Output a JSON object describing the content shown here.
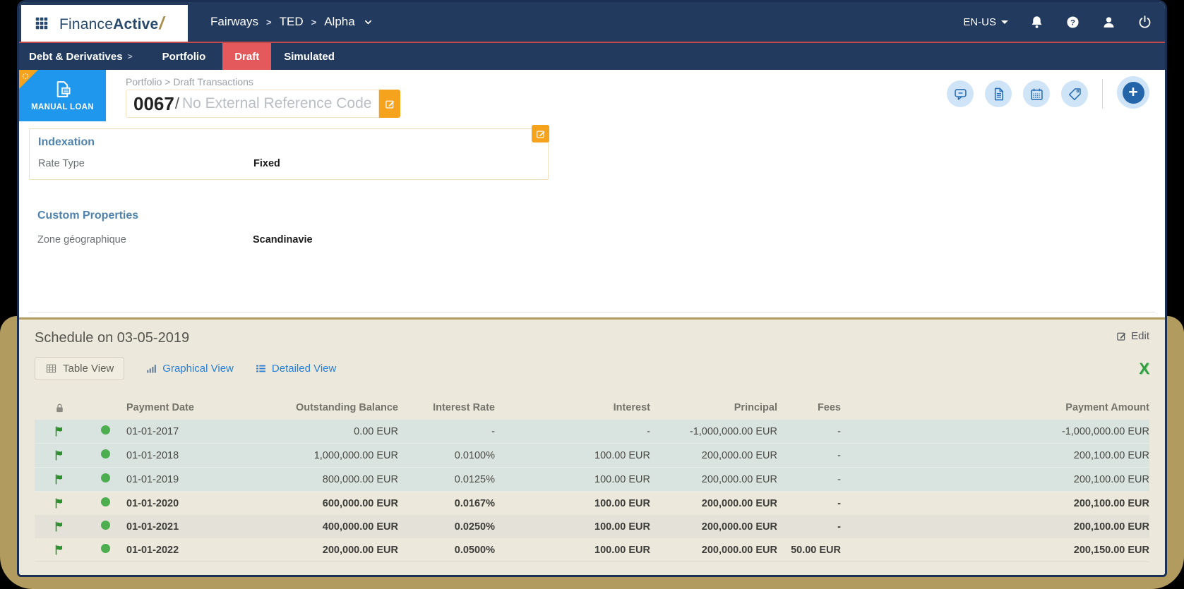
{
  "topnav": {
    "logo_part1": "Finance",
    "logo_part2": "Active",
    "logo_slash": "/",
    "breadcrumb": {
      "org": "Fairways",
      "group": "TED",
      "entity": "Alpha"
    },
    "crumb_sep": ">",
    "language": "EN-US"
  },
  "subnav": {
    "items": [
      {
        "label": "Debt & Derivatives",
        "chevron": ">"
      },
      {
        "label": "Portfolio"
      },
      {
        "label": "Draft",
        "active": true
      },
      {
        "label": "Simulated"
      }
    ]
  },
  "header": {
    "badge_label": "MANUAL LOAN",
    "breadcrumb": "Portfolio > Draft Transactions",
    "loan_code": "0067",
    "separator": "/",
    "reference_placeholder": "No External Reference Code",
    "add_symbol": "+"
  },
  "sections": {
    "indexation": {
      "title": "Indexation",
      "fields": [
        {
          "label": "Rate Type",
          "value": "Fixed"
        }
      ]
    },
    "custom_properties": {
      "title": "Custom Properties",
      "fields": [
        {
          "label": "Zone géographique",
          "value": "Scandinavie"
        }
      ]
    }
  },
  "schedule": {
    "title": "Schedule on 03-05-2019",
    "edit_label": "Edit",
    "export_symbol": "X",
    "tabs": [
      {
        "label": "Table View",
        "active": true
      },
      {
        "label": "Graphical View"
      },
      {
        "label": "Detailed View"
      }
    ],
    "table": {
      "columns": [
        "Payment Date",
        "Outstanding Balance",
        "Interest Rate",
        "Interest",
        "Principal",
        "Fees",
        "Payment Amount"
      ],
      "rows": [
        {
          "date": "01-01-2017",
          "balance": "0.00 EUR",
          "rate": "-",
          "interest": "-",
          "principal": "-1,000,000.00 EUR",
          "fees": "-",
          "amount": "-1,000,000.00 EUR"
        },
        {
          "date": "01-01-2018",
          "balance": "1,000,000.00 EUR",
          "rate": "0.0100%",
          "interest": "100.00 EUR",
          "principal": "200,000.00 EUR",
          "fees": "-",
          "amount": "200,100.00 EUR"
        },
        {
          "date": "01-01-2019",
          "balance": "800,000.00 EUR",
          "rate": "0.0125%",
          "interest": "100.00 EUR",
          "principal": "200,000.00 EUR",
          "fees": "-",
          "amount": "200,100.00 EUR"
        },
        {
          "date": "01-01-2020",
          "balance": "600,000.00 EUR",
          "rate": "0.0167%",
          "interest": "100.00 EUR",
          "principal": "200,000.00 EUR",
          "fees": "-",
          "amount": "200,100.00 EUR"
        },
        {
          "date": "01-01-2021",
          "balance": "400,000.00 EUR",
          "rate": "0.0250%",
          "interest": "100.00 EUR",
          "principal": "200,000.00 EUR",
          "fees": "-",
          "amount": "200,100.00 EUR"
        },
        {
          "date": "01-01-2022",
          "balance": "200,000.00 EUR",
          "rate": "0.0500%",
          "interest": "100.00 EUR",
          "principal": "200,000.00 EUR",
          "fees": "50.00 EUR",
          "amount": "200,150.00 EUR"
        }
      ]
    }
  },
  "icons": {
    "app_launcher": "grid-3x3",
    "nav_right": [
      "bell",
      "help",
      "user",
      "power"
    ],
    "context_caret": "chevron-down",
    "badge_corner": "spinner-dots",
    "badge_glyph": "document",
    "title_actions": [
      "comment",
      "document",
      "calendar",
      "tag",
      "add"
    ],
    "edit_buttons": "pencil-square",
    "table_header": "lock",
    "row_status": [
      "flag",
      "green-dot"
    ],
    "tab_glyphs": [
      "table-grid",
      "bar-chart",
      "list"
    ],
    "export": "excel-x"
  },
  "colors": {
    "navy": "#213a5e",
    "red_accent": "#e4595c",
    "red_divider": "#c4494b",
    "blue_badge": "#1f97ec",
    "orange_accent": "#f5a21d",
    "link_blue": "#2a7fd4",
    "section_heading_blue": "#4f83ad",
    "highlight_tan": "#b29b5e",
    "panel_beige": "#ece8dc",
    "past_row_bg": "#d9e3e0",
    "alt_row_bg": "#e4e1d8",
    "flag_green": "#2e8f2e",
    "excel_green": "#2f9e40"
  }
}
